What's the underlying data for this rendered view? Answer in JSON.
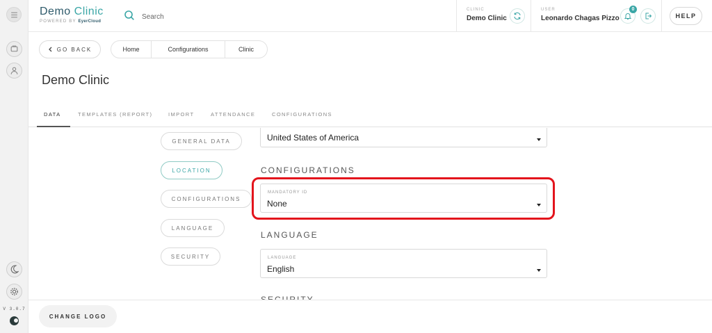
{
  "brand": {
    "title_main": "Demo",
    "title_accent": "Clinic",
    "powered_prefix": "POWERED BY",
    "powered_name": "EyerCloud"
  },
  "search": {
    "placeholder": "Search"
  },
  "header": {
    "clinic_caption": "CLINIC",
    "clinic_value": "Demo Clinic",
    "user_caption": "USER",
    "user_value": "Leonardo Chagas Pizzo",
    "notification_count": "0",
    "help_label": "HELP"
  },
  "nav": {
    "back_label": "GO BACK",
    "breadcrumb": [
      "Home",
      "Configurations",
      "Clinic"
    ]
  },
  "page": {
    "title": "Demo Clinic"
  },
  "tabs": [
    "DATA",
    "TEMPLATES (REPORT)",
    "IMPORT",
    "ATTENDANCE",
    "CONFIGURATIONS"
  ],
  "side_nav": [
    "GENERAL DATA",
    "LOCATION",
    "CONFIGURATIONS",
    "LANGUAGE",
    "SECURITY"
  ],
  "form": {
    "country_value": "United States of America",
    "configurations_heading": "CONFIGURATIONS",
    "mandatory_id_caption": "MANDATORY ID",
    "mandatory_id_value": "None",
    "language_heading": "LANGUAGE",
    "language_caption": "LANGUAGE",
    "language_value": "English",
    "security_heading": "SECURITY"
  },
  "footer": {
    "change_logo_label": "CHANGE LOGO"
  },
  "version": "V 3.0.7",
  "colors": {
    "accent": "#3aa6a6",
    "brand_dark": "#2e5a6a",
    "highlight": "#e3141c"
  }
}
